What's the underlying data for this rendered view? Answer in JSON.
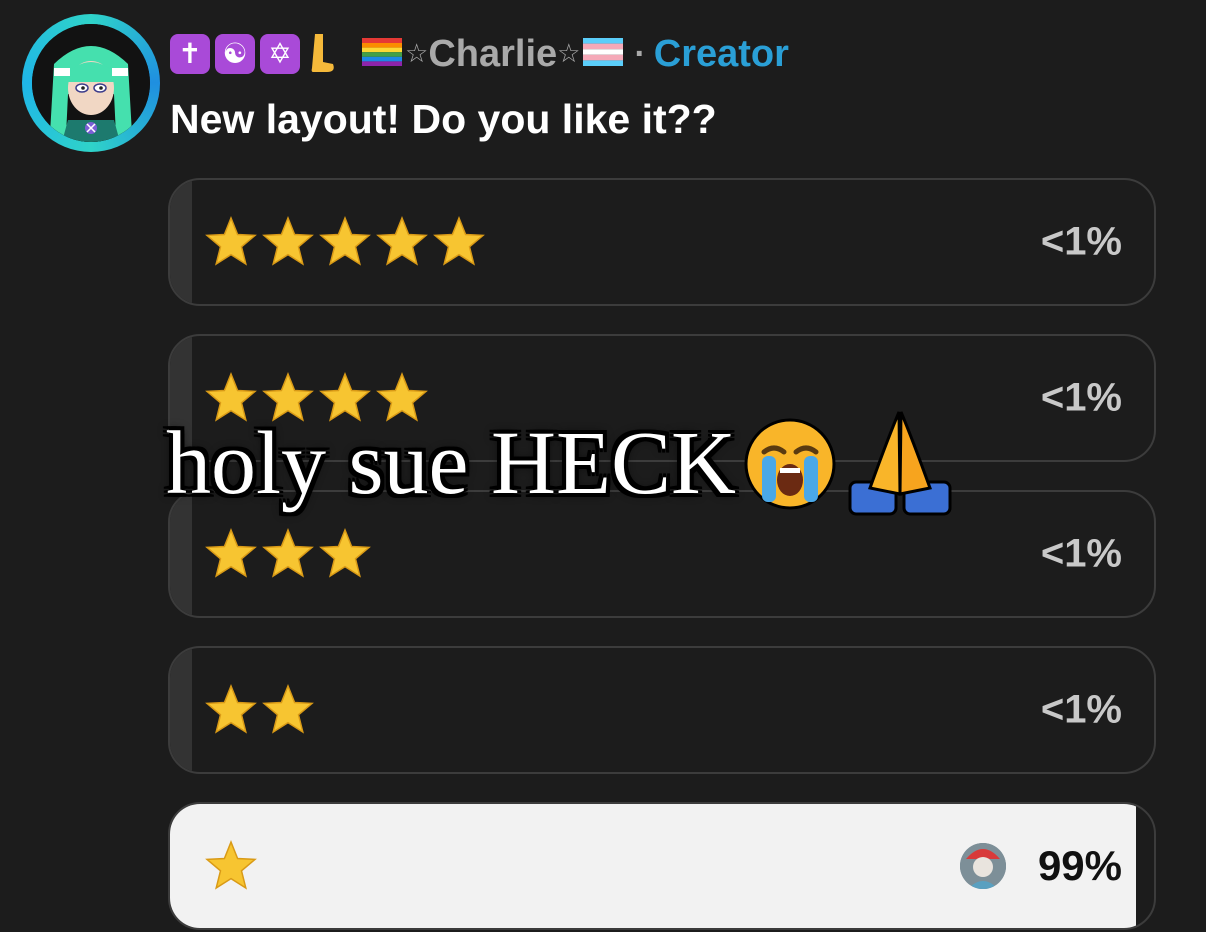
{
  "post": {
    "badges": [
      "✝",
      "☯",
      "✡"
    ],
    "leg_icon": "leg-icon",
    "author": {
      "flag_left": "rainbow-flag-icon",
      "star_left": "☆",
      "name": "Charlie",
      "star_right": "☆",
      "flag_right": "trans-flag-icon"
    },
    "separator": "·",
    "role": "Creator",
    "title": "New layout! Do you like it??"
  },
  "poll": {
    "options": [
      {
        "stars": 5,
        "label": "★★★★★",
        "percent": "<1%",
        "selected": false
      },
      {
        "stars": 4,
        "label": "★★★★",
        "percent": "<1%",
        "selected": false
      },
      {
        "stars": 3,
        "label": "★★★",
        "percent": "<1%",
        "selected": false
      },
      {
        "stars": 2,
        "label": "★★",
        "percent": "<1%",
        "selected": false
      },
      {
        "stars": 1,
        "label": "★",
        "percent": "99%",
        "selected": true
      }
    ]
  },
  "caption": {
    "text": "holy sue HECK",
    "emojis": [
      "loudly-crying-face-icon",
      "folded-hands-icon"
    ]
  },
  "colors": {
    "background": "#1c1c1c",
    "creator": "#2a9fd6",
    "badge": "#a94ad8",
    "star": "#f7c531",
    "selected_fill": "#f2f2f2"
  }
}
